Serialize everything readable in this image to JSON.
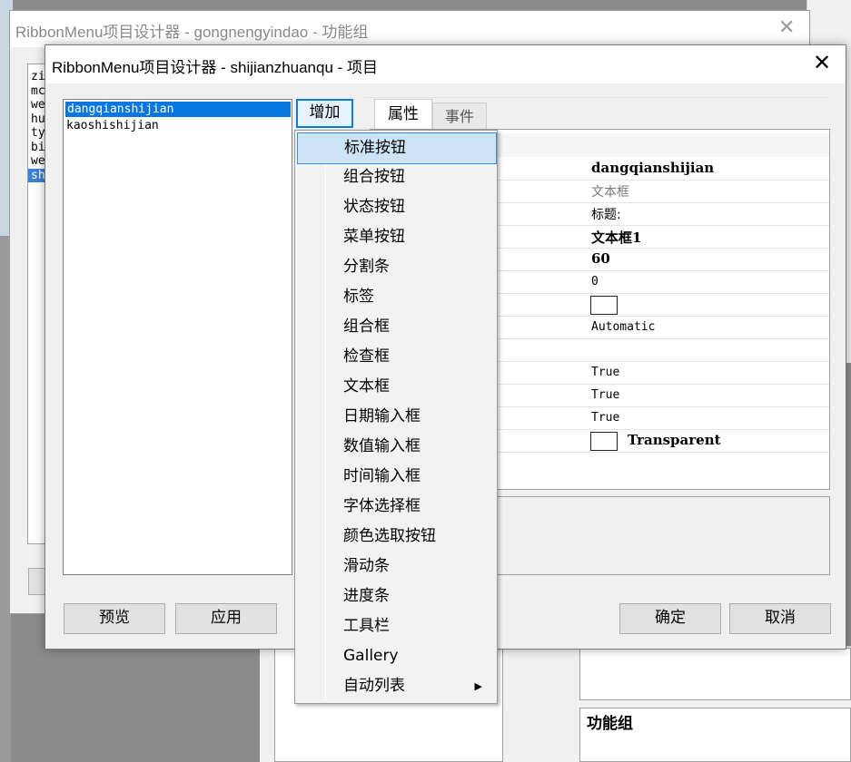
{
  "back_window": {
    "title": "RibbonMenu项目设计器 - gongnengyindao - 功能组",
    "list_items": [
      "zi",
      "mc",
      "we",
      "hu",
      "ty",
      "bi",
      "we",
      "sh"
    ],
    "selected_index": 7
  },
  "background": {
    "bottom_label": "功能组"
  },
  "dialog": {
    "title": "RibbonMenu项目设计器 - shijianzhuanqu - 项目",
    "items": [
      "dangqianshijian",
      "kaoshishijian"
    ],
    "selected_index": 0,
    "add_button": "增加",
    "tabs": [
      {
        "label": "属性",
        "active": true
      },
      {
        "label": "事件",
        "active": false
      }
    ],
    "properties": [
      {
        "value": "dangqianshijian",
        "style": "bold"
      },
      {
        "value": "文本框",
        "style": "gray"
      },
      {
        "value": "标题:",
        "style": "normal"
      },
      {
        "value": "文本框1",
        "style": "bold"
      },
      {
        "value": "60",
        "style": "bold"
      },
      {
        "value": "0",
        "style": "mono"
      },
      {
        "value": "",
        "style": "swatch"
      },
      {
        "value": "Automatic",
        "style": "mono"
      },
      {
        "value": "",
        "style": "empty"
      },
      {
        "value": "True",
        "style": "mono"
      },
      {
        "value": "True",
        "style": "mono"
      },
      {
        "value": "True",
        "style": "mono"
      },
      {
        "value": "Transparent",
        "style": "swatch-bold"
      }
    ],
    "buttons": {
      "preview": "预览",
      "apply": "应用",
      "ok": "确定",
      "cancel": "取消"
    }
  },
  "menu": {
    "items": [
      {
        "label": "标准按钮",
        "highlighted": true,
        "submenu": false
      },
      {
        "label": "组合按钮",
        "highlighted": false,
        "submenu": false
      },
      {
        "label": "状态按钮",
        "highlighted": false,
        "submenu": false
      },
      {
        "label": "菜单按钮",
        "highlighted": false,
        "submenu": false
      },
      {
        "label": "分割条",
        "highlighted": false,
        "submenu": false
      },
      {
        "label": "标签",
        "highlighted": false,
        "submenu": false
      },
      {
        "label": "组合框",
        "highlighted": false,
        "submenu": false
      },
      {
        "label": "检查框",
        "highlighted": false,
        "submenu": false
      },
      {
        "label": "文本框",
        "highlighted": false,
        "submenu": false
      },
      {
        "label": "日期输入框",
        "highlighted": false,
        "submenu": false
      },
      {
        "label": "数值输入框",
        "highlighted": false,
        "submenu": false
      },
      {
        "label": "时间输入框",
        "highlighted": false,
        "submenu": false
      },
      {
        "label": "字体选择框",
        "highlighted": false,
        "submenu": false
      },
      {
        "label": "颜色选取按钮",
        "highlighted": false,
        "submenu": false
      },
      {
        "label": "滑动条",
        "highlighted": false,
        "submenu": false
      },
      {
        "label": "进度条",
        "highlighted": false,
        "submenu": false
      },
      {
        "label": "工具栏",
        "highlighted": false,
        "submenu": false
      },
      {
        "label": "Gallery",
        "highlighted": false,
        "submenu": false
      },
      {
        "label": "自动列表",
        "highlighted": false,
        "submenu": true
      }
    ]
  },
  "colors": {
    "selection": "#0a76e0",
    "menu_highlight": "#cce4f7",
    "menu_highlight_border": "#3f8fd8"
  }
}
